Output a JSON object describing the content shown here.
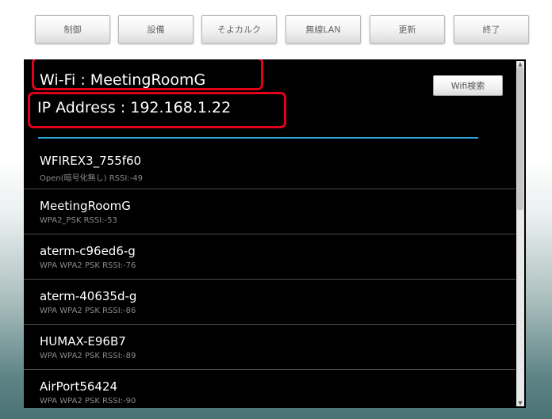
{
  "toolbar": {
    "buttons": [
      "制御",
      "設備",
      "そよカルク",
      "無線LAN",
      "更新",
      "終了"
    ]
  },
  "status": {
    "wifi": "Wi-Fi : MeetingRoomG",
    "ip": "IP Address : 192.168.1.22"
  },
  "search_button": "Wifi検索",
  "networks": [
    {
      "name": "WFIREX3_755f60",
      "detail": "Open(暗号化無し) RSSI:-49"
    },
    {
      "name": "MeetingRoomG",
      "detail": "WPA2_PSK RSSI:-53"
    },
    {
      "name": "aterm-c96ed6-g",
      "detail": "WPA WPA2 PSK RSSI:-76"
    },
    {
      "name": "aterm-40635d-g",
      "detail": "WPA WPA2 PSK RSSI:-86"
    },
    {
      "name": "HUMAX-E96B7",
      "detail": "WPA WPA2 PSK RSSI:-89"
    },
    {
      "name": "AirPort56424",
      "detail": "WPA WPA2 PSK RSSI:-90"
    }
  ],
  "colors": {
    "highlight": "#e3001b",
    "divider": "#2aa7d6",
    "panel_bg": "#000000"
  },
  "icons": {
    "scroll_up": "scroll-up-arrow-icon",
    "scroll_down": "scroll-down-arrow-icon"
  }
}
